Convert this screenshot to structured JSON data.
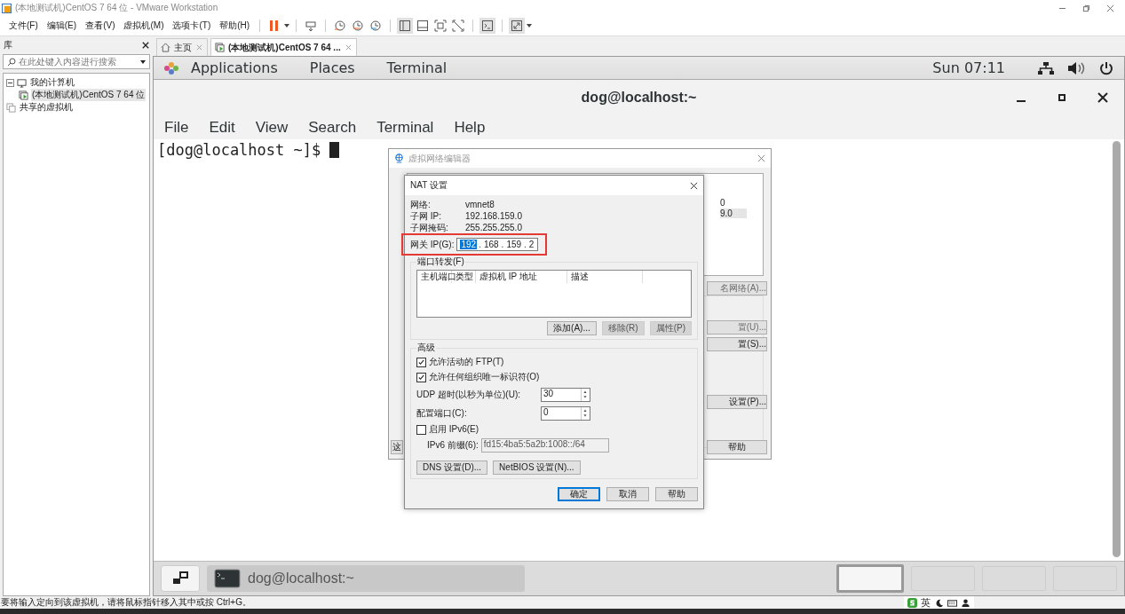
{
  "window": {
    "title": "(本地测试机)CentOS 7 64 位 - VMware Workstation"
  },
  "menu": [
    "文件(F)",
    "编辑(E)",
    "查看(V)",
    "虚拟机(M)",
    "选项卡(T)",
    "帮助(H)"
  ],
  "library": {
    "title": "库",
    "search": {
      "placeholder": "在此处键入内容进行搜索"
    },
    "tree": [
      {
        "label": "我的计算机",
        "kind": "computer",
        "expanded": true,
        "selected": false,
        "children": [
          {
            "label": "(本地测试机)CentOS 7 64 位",
            "kind": "vm",
            "selected": true
          }
        ]
      },
      {
        "label": "共享的虚拟机",
        "kind": "shared",
        "selected": false
      }
    ]
  },
  "tabs": [
    {
      "label": "主页",
      "kind": "home",
      "selected": false
    },
    {
      "label": "(本地测试机)CentOS 7 64 ...",
      "kind": "vm",
      "selected": true
    }
  ],
  "guest": {
    "top_bar": {
      "menus": [
        "Applications",
        "Places",
        "Terminal"
      ],
      "clock": "Sun 07:11"
    },
    "terminal": {
      "title": "dog@localhost:~",
      "menu": [
        "File",
        "Edit",
        "View",
        "Search",
        "Terminal",
        "Help"
      ],
      "prompt": "[dog@localhost ~]$ "
    },
    "taskbar": {
      "windows": [
        {
          "label": "dog@localhost:~",
          "selected": true
        }
      ],
      "workspaces": [
        {
          "selected": true
        },
        {
          "selected": false
        },
        {
          "selected": false
        },
        {
          "selected": false
        }
      ]
    }
  },
  "network_editor": {
    "title": "虚拟网络编辑器",
    "cells": [
      "0",
      "9.0"
    ],
    "buttons": [
      {
        "label": "名网络(A)...",
        "disabled": true
      },
      {
        "label": "置(U)...",
        "disabled": true
      },
      {
        "label": "置(S)...",
        "disabled": false
      },
      {
        "label": "设置(P)...",
        "disabled": false
      },
      {
        "label": "帮助",
        "disabled": false
      }
    ],
    "left_button": "这"
  },
  "nat_dialog": {
    "title": "NAT 设置",
    "info": [
      {
        "label": "网络:",
        "value": "vmnet8"
      },
      {
        "label": "子网 IP:",
        "value": "192.168.159.0"
      },
      {
        "label": "子网掩码:",
        "value": "255.255.255.0"
      }
    ],
    "gateway": {
      "label": "网关 IP(G):",
      "highlighted": true,
      "separator": ".",
      "octets": [
        {
          "text": "192",
          "selected": true
        },
        {
          "text": "168",
          "selected": false
        },
        {
          "text": "159",
          "selected": false
        },
        {
          "text": "2",
          "selected": false
        }
      ]
    },
    "port_forwarding": {
      "title": "端口转发(F)",
      "columns": [
        "主机端口",
        "类型",
        "虚拟机 IP 地址",
        "描述"
      ],
      "buttons": [
        {
          "label": "添加(A)...",
          "disabled": false
        },
        {
          "label": "移除(R)",
          "disabled": true
        },
        {
          "label": "属性(P)",
          "disabled": true
        }
      ]
    },
    "advanced": {
      "title": "高级",
      "options": [
        {
          "label": "允许活动的 FTP(T)",
          "checked": true
        },
        {
          "label": "允许任何组织唯一标识符(O)",
          "checked": true
        }
      ],
      "udp_timeout": {
        "label": "UDP 超时(以秒为单位)(U):",
        "value": "30"
      },
      "config_port": {
        "label": "配置端口(C):",
        "value": "0"
      },
      "ipv6": {
        "label": "启用 IPv6(E)",
        "checked": false
      },
      "ipv6_prefix": {
        "label": "IPv6 前缀(6):",
        "value": "fd15:4ba5:5a2b:1008::/64"
      },
      "buttons": [
        "DNS 设置(D)...",
        "NetBIOS 设置(N)..."
      ]
    },
    "buttons": [
      {
        "label": "确定",
        "kind": "default"
      },
      {
        "label": "取消",
        "kind": "normal"
      },
      {
        "label": "帮助",
        "kind": "normal"
      }
    ]
  },
  "status_bar": "要将输入定向到该虚拟机，请将鼠标指针移入其中或按 Ctrl+G。",
  "ime": {
    "language": "英"
  }
}
